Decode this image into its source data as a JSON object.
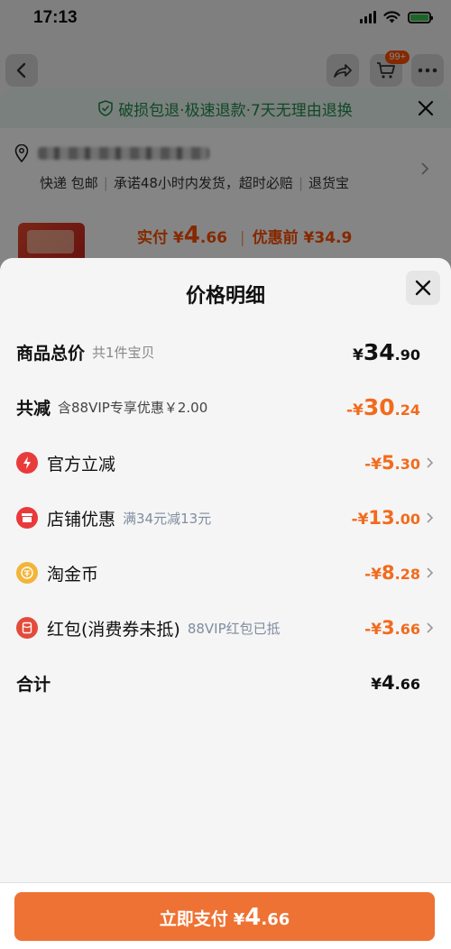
{
  "status_bar": {
    "time": "17:13"
  },
  "header": {
    "cart_badge": "99+"
  },
  "background": {
    "guarantee_text": "破损包退·极速退款·7天无理由退换",
    "shipping": [
      "快递 包邮",
      "承诺48小时内发货，超时必赔",
      "退货宝"
    ],
    "price_label": "实付",
    "price_currency": "¥",
    "price_int": "4",
    "price_dec": ".66",
    "before_label": "优惠前 ¥34.9"
  },
  "sheet": {
    "title": "价格明细",
    "rows": [
      {
        "label": "商品总价",
        "sub": "共1件宝贝",
        "currency": "¥",
        "int": "34",
        "dec": ".90"
      },
      {
        "label": "共减",
        "sub": "含88VIP专享优惠￥2.00",
        "currency": "-¥",
        "int": "30",
        "dec": ".24"
      },
      {
        "label": "官方立减",
        "sub": "",
        "currency": "-¥",
        "int": "5",
        "dec": ".30"
      },
      {
        "label": "店铺优惠",
        "sub": "满34元减13元",
        "currency": "-¥",
        "int": "13",
        "dec": ".00"
      },
      {
        "label": "淘金币",
        "sub": "",
        "currency": "-¥",
        "int": "8",
        "dec": ".28"
      },
      {
        "label": "红包(消费券未抵)",
        "sub": "88VIP红包已抵",
        "currency": "-¥",
        "int": "3",
        "dec": ".66"
      },
      {
        "label": "合计",
        "sub": "",
        "currency": "¥",
        "int": "4",
        "dec": ".66"
      }
    ],
    "icons": [
      "lightning-icon",
      "shop-icon",
      "coin-icon",
      "red-packet-icon"
    ]
  },
  "pay_button": {
    "label": "立即支付",
    "currency": "¥",
    "int": "4",
    "dec": ".66"
  },
  "colors": {
    "accent": "#ee7233",
    "discount": "#f26b1d",
    "guarantee_green": "#1f8b4c"
  }
}
